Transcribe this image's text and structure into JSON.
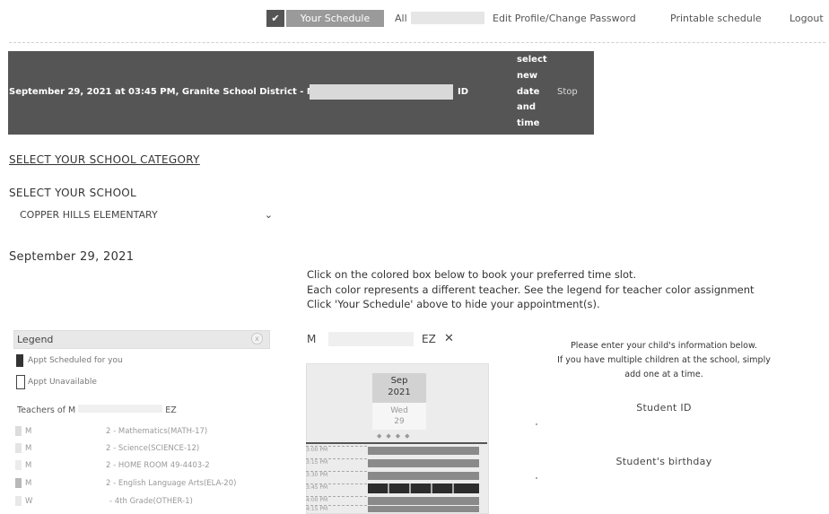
{
  "nav": {
    "check_icon": "✔",
    "your_schedule": "Your Schedule",
    "all": "All",
    "edit_profile": "Edit Profile/Change Password",
    "printable": "Printable schedule",
    "logout": "Logout"
  },
  "banner": {
    "text": "September 29, 2021 at 03:45 PM, Granite School District - M",
    "id_suffix": "ID",
    "choices": [
      "select",
      "new",
      "date",
      "and",
      "time"
    ],
    "stop": "Stop"
  },
  "category_link": "SELECT YOUR SCHOOL CATEGORY",
  "school": {
    "label": "SELECT YOUR SCHOOL",
    "selected": "COPPER HILLS ELEMENTARY"
  },
  "date_heading": "September 29, 2021",
  "instructions": [
    "Click on the colored box below to book your preferred time slot.",
    "Each color represents a different teacher. See the legend for teacher color assignment",
    "Click 'Your Schedule' above to hide your appointment(s)."
  ],
  "legend": {
    "title": "Legend",
    "close_icon": "x",
    "scheduled": "Appt Scheduled for you",
    "unavailable": "Appt Unavailable",
    "teachers_heading_prefix": "Teachers of M",
    "teachers_heading_suffix": "EZ",
    "teachers": [
      {
        "initial": "M",
        "subject": "2 - Mathematics(MATH-17)"
      },
      {
        "initial": "M",
        "subject": "2 - Science(SCIENCE-12)"
      },
      {
        "initial": "M",
        "subject": "2 - HOME ROOM 49-4403-2"
      },
      {
        "initial": "M",
        "subject": "2 - English Language Arts(ELA-20)"
      },
      {
        "initial": "W",
        "subject": "- 4th Grade(OTHER-1)"
      }
    ]
  },
  "student": {
    "name_prefix": "M",
    "name_suffix": "EZ",
    "close": "✕"
  },
  "calendar": {
    "month": "Sep",
    "year": "2021",
    "weekday": "Wed",
    "day": "29",
    "nav": "◆◆◆◆",
    "slots": [
      "3:00 PM",
      "3:15 PM",
      "3:30 PM",
      "3:45 PM",
      "4:00 PM",
      "4:15 PM"
    ]
  },
  "form": {
    "intro": [
      "Please enter your child's information below.",
      "If you have multiple children at the school, simply",
      "add one at a time."
    ],
    "student_id_label": "Student ID",
    "birthday_label": "Student's birthday"
  }
}
